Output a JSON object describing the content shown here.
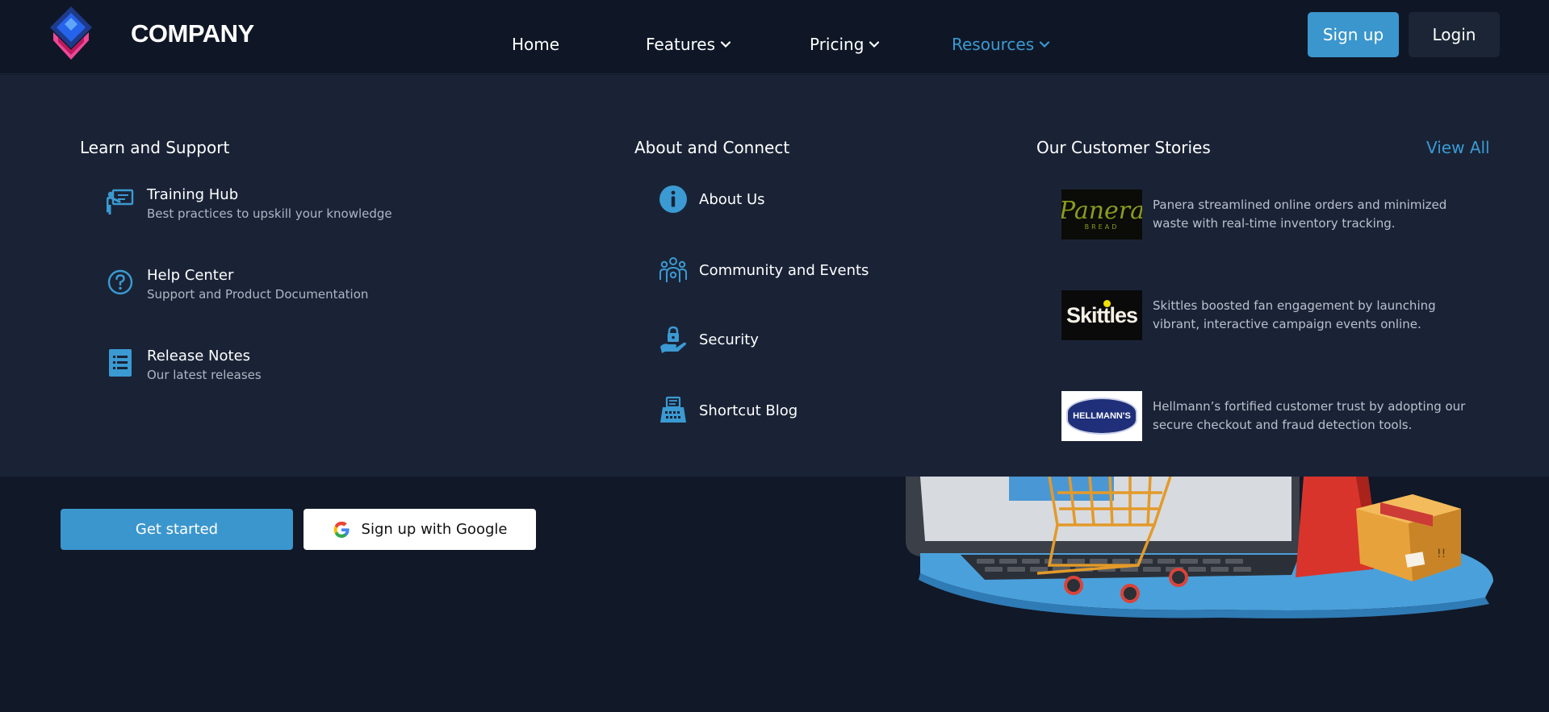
{
  "brand": {
    "name": "COMPANY"
  },
  "nav": {
    "items": [
      {
        "label": "Home",
        "has_dropdown": false,
        "active": false
      },
      {
        "label": "Features",
        "has_dropdown": true,
        "active": false
      },
      {
        "label": "Pricing",
        "has_dropdown": true,
        "active": false
      },
      {
        "label": "Resources",
        "has_dropdown": true,
        "active": true
      }
    ],
    "signup_label": "Sign up",
    "login_label": "Login"
  },
  "menu": {
    "learn": {
      "title": "Learn and Support",
      "items": [
        {
          "icon": "presentation-icon",
          "title": "Training Hub",
          "subtitle": "Best practices to upskill your knowledge"
        },
        {
          "icon": "question-circle-icon",
          "title": "Help Center",
          "subtitle": "Support and Product Documentation"
        },
        {
          "icon": "document-list-icon",
          "title": "Release Notes",
          "subtitle": "Our latest releases"
        }
      ]
    },
    "about": {
      "title": "About and Connect",
      "items": [
        {
          "icon": "info-icon",
          "label": "About Us"
        },
        {
          "icon": "community-icon",
          "label": "Community and Events"
        },
        {
          "icon": "security-lock-hand-icon",
          "label": "Security"
        },
        {
          "icon": "typewriter-icon",
          "label": "Shortcut Blog"
        }
      ]
    },
    "stories": {
      "title": "Our Customer Stories",
      "view_all": "View All",
      "items": [
        {
          "logo": "Panera",
          "logo_sub": "BREAD",
          "text": "Panera streamlined online orders and minimized waste with real-time inventory tracking."
        },
        {
          "logo": "Skittles",
          "text": "Skittles boosted fan engagement by launching vibrant, interactive campaign events online."
        },
        {
          "logo": "HELLMANN'S",
          "text": "Hellmann’s fortified customer trust by adopting our secure checkout and fraud detection tools."
        }
      ]
    }
  },
  "hero": {
    "get_started": "Get started",
    "google_signup": "Sign up with Google"
  },
  "colors": {
    "accent": "#3b96cd",
    "nav_bg": "#0f1726",
    "menu_bg": "#1a2336",
    "page_bg": "#111827"
  }
}
